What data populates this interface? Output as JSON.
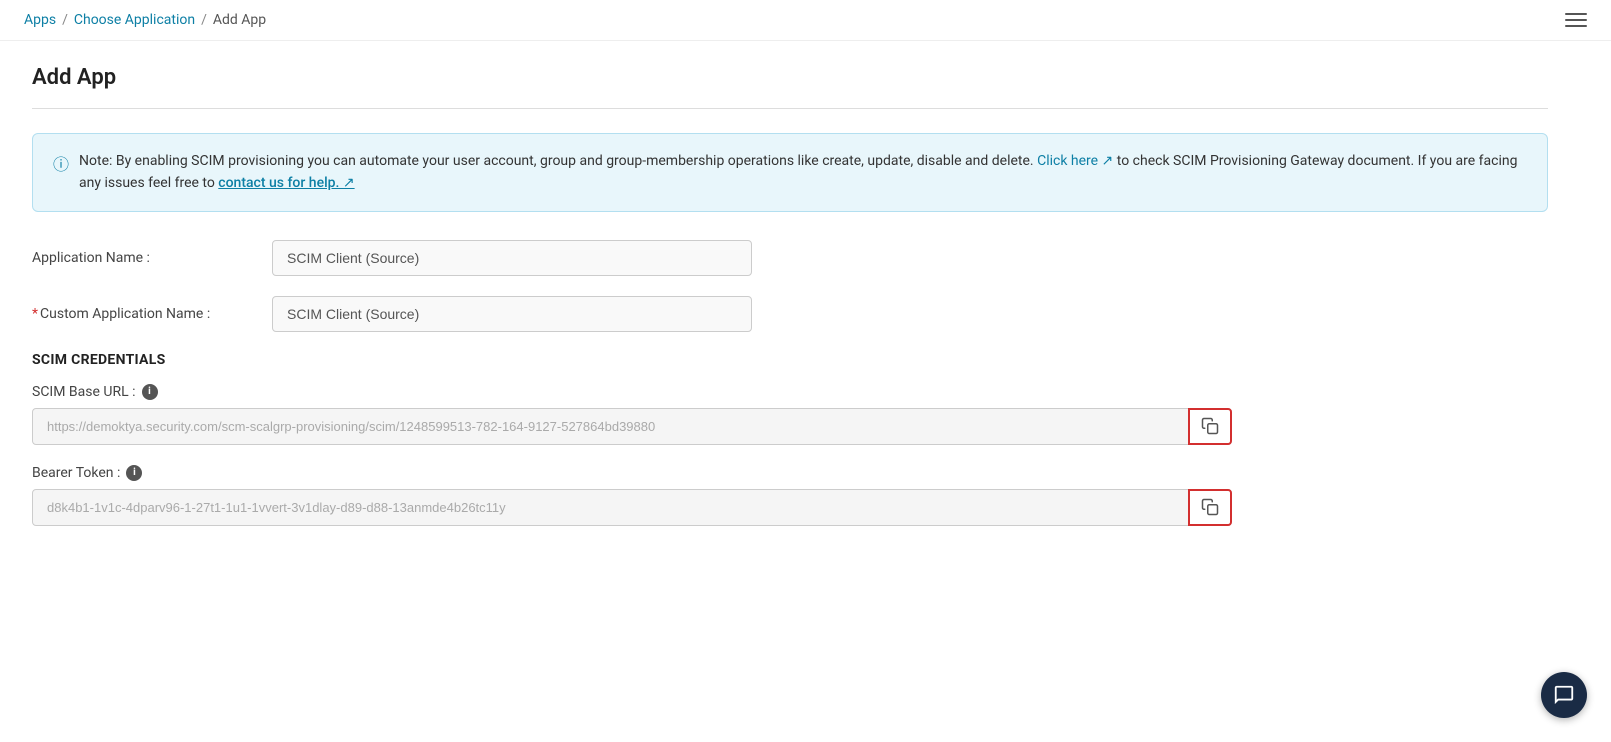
{
  "breadcrumb": {
    "apps_label": "Apps",
    "choose_app_label": "Choose Application",
    "current_label": "Add App",
    "separator": "/"
  },
  "header": {
    "page_title": "Add App"
  },
  "banner": {
    "text_before_link": "Note: By enabling SCIM provisioning you can automate your user account, group and group-membership operations like create, update, disable and delete.",
    "click_here_label": "Click here",
    "text_middle": "to check SCIM Provisioning Gateway document. If you are facing any issues feel free to",
    "contact_label": "contact us for help.",
    "external_icon": "↗"
  },
  "form": {
    "app_name_label": "Application Name :",
    "app_name_value": "SCIM Client (Source)",
    "custom_name_label": "Custom Application Name :",
    "custom_name_value": "SCIM Client (Source)",
    "required_marker": "*"
  },
  "scim": {
    "section_title": "SCIM CREDENTIALS",
    "base_url_label": "SCIM Base URL :",
    "base_url_value": "https://demoktya.security.com/scm-scalgrp-provisioning/scim/1248599513-782-164-9127-527864bd39880",
    "base_url_placeholder": "https://demoktya.security.com/scm-scalgrp-provisioning/scim/1248599513-782-164-9127-527864bd39880",
    "bearer_token_label": "Bearer Token :",
    "bearer_token_value": "d8k4b1-1v1c-4dparv96-1-27t1-1u1-1vvert-3v1dlay-d89-d88-13anmde4b26tc11y",
    "bearer_token_placeholder": "d8k4b1-1v1c-4dparv96-1-27t1-1u1-1vvert-3v1dlay-d89-d88-13anmde4b26tc11y",
    "copy_button_title": "Copy"
  }
}
